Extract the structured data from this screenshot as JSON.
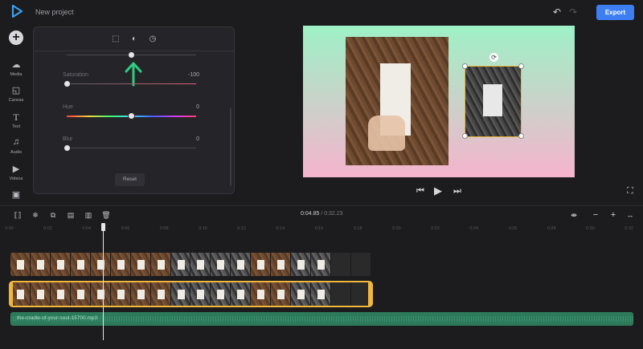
{
  "app": {
    "project_title": "New project"
  },
  "header": {
    "export_label": "Export"
  },
  "sidebar": {
    "items": [
      {
        "label": "Media",
        "icon": "cloud-upload-icon"
      },
      {
        "label": "Canvas",
        "icon": "canvas-icon"
      },
      {
        "label": "Text",
        "icon": "text-icon"
      },
      {
        "label": "Audio",
        "icon": "music-note-icon"
      },
      {
        "label": "Videos",
        "icon": "video-icon"
      },
      {
        "label": "",
        "icon": "image-icon"
      }
    ]
  },
  "adjust_panel": {
    "tabs": [
      {
        "icon": "crop-icon"
      },
      {
        "icon": "contrast-icon",
        "active": true
      },
      {
        "icon": "speed-icon"
      }
    ],
    "sliders": [
      {
        "label": "",
        "value": "",
        "level": 0.5
      },
      {
        "label": "Saturation",
        "value": "-100",
        "level": 0.0
      },
      {
        "label": "Hue",
        "value": "0",
        "level": 0.5
      },
      {
        "label": "Blur",
        "value": "0",
        "level": 0.0
      }
    ],
    "reset_label": "Reset",
    "annotation_arrow_color": "#2ecc7f"
  },
  "timeline": {
    "current_time": "0:04.85",
    "total_time": "0:32.23",
    "ruler_ticks": [
      "0:00",
      "0:02",
      "0:04",
      "0:06",
      "0:08",
      "0:10",
      "0:12",
      "0:14",
      "0:16",
      "0:18",
      "0:20",
      "0:22",
      "0:24",
      "0:26",
      "0:28",
      "0:30",
      "0:32"
    ],
    "audio_track_name": "the-cradle-of-your-soul-15700.mp3"
  },
  "colors": {
    "accent": "#3d7ff3",
    "selection": "#f0b73c",
    "audio": "#2d7a5b",
    "preview_top": "#9ef1c6",
    "preview_bottom": "#f5b4cd"
  }
}
